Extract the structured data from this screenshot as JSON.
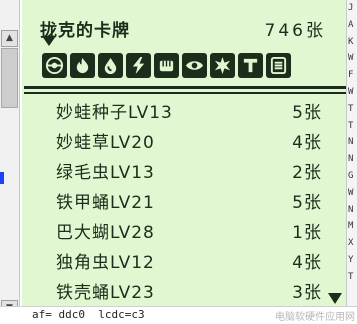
{
  "screen": {
    "title": "拢克的卡牌",
    "count": "746张",
    "type_icons": [
      "pokeball-icon",
      "fire-icon",
      "water-icon",
      "lightning-icon",
      "fighting-icon",
      "psychic-icon",
      "colorless-icon",
      "trainer-icon",
      "energy-icon"
    ],
    "cards": [
      {
        "name": "妙蛙种子LV13",
        "qty": "5张"
      },
      {
        "name": "妙蛙草LV20",
        "qty": "4张"
      },
      {
        "name": "绿毛虫LV13",
        "qty": "2张"
      },
      {
        "name": "铁甲蛹LV21",
        "qty": "5张"
      },
      {
        "name": "巴大蝴LV28",
        "qty": "1张"
      },
      {
        "name": "独角虫LV12",
        "qty": "4张"
      },
      {
        "name": "铁壳蛹LV23",
        "qty": "3张"
      }
    ]
  },
  "side_panel": {
    "letters": [
      "J",
      "A",
      "K",
      "W",
      "F",
      "W",
      "T",
      "T",
      "N",
      "N",
      "G",
      "W",
      "N",
      "M",
      "X",
      "Y",
      "T"
    ]
  },
  "status": {
    "text": "af= ddc0  lcdc=c3",
    "watermark": "电脑软硬件应用网"
  }
}
